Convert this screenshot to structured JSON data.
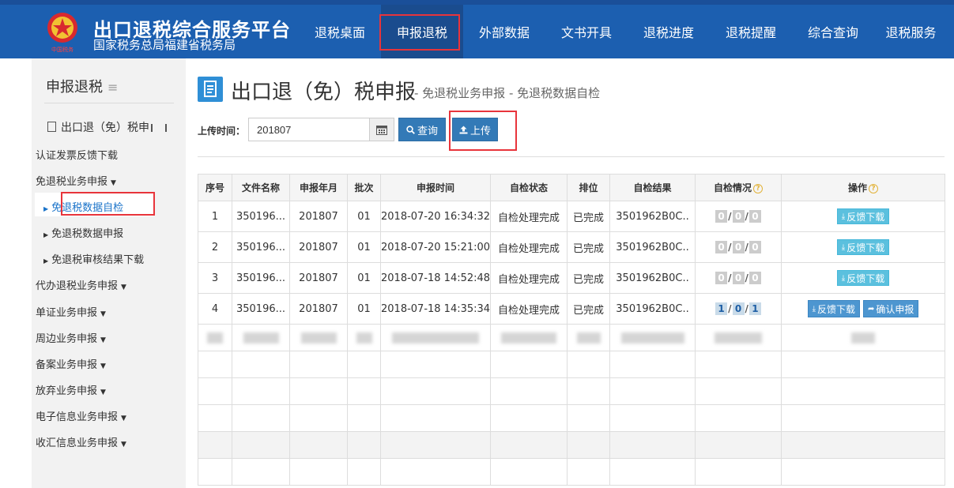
{
  "header": {
    "title": "出口退税综合服务平台",
    "subtitle": "国家税务总局福建省税务局",
    "logo_seal_text": "中国税务",
    "nav": [
      "退税桌面",
      "申报退税",
      "外部数据",
      "文书开具",
      "退税进度",
      "退税提醒",
      "综合查询",
      "退税服务"
    ],
    "active_nav": "申报退税"
  },
  "sidebar": {
    "title": "申报退税",
    "root": "出口退（免）税申",
    "items": [
      {
        "label": "认证发票反馈下载",
        "caret": false
      },
      {
        "label": "免退税业务申报",
        "caret": true
      }
    ],
    "sub_items": [
      "免退税数据自检",
      "免退税数据申报",
      "免退税审核结果下载"
    ],
    "active_sub": "免退税数据自检",
    "groups": [
      "代办退税业务申报",
      "单证业务申报",
      "周边业务申报",
      "备案业务申报",
      "放弃业务申报",
      "电子信息业务申报",
      "收汇信息业务申报"
    ]
  },
  "main": {
    "title": "出口退（免）税申报",
    "crumb": "- 免退税业务申报  - 免退税数据自检",
    "upload_time_label": "上传时间：",
    "upload_time_value": "201807",
    "query_label": "查询",
    "upload_label": "上传"
  },
  "table": {
    "headers": [
      "序号",
      "文件名称",
      "申报年月",
      "批次",
      "申报时间",
      "自检状态",
      "排位",
      "自检结果",
      "自检情况",
      "操作"
    ],
    "rows": [
      {
        "no": "1",
        "file": "350196...",
        "ym": "201807",
        "batch": "01",
        "time": "2018-07-20 16:34:32",
        "status": "自检处理完成",
        "rank": "已完成",
        "result": "3501962B0C..",
        "c": [
          "0",
          "0",
          "0"
        ],
        "active": false,
        "ops": [
          "反馈下载"
        ]
      },
      {
        "no": "2",
        "file": "350196...",
        "ym": "201807",
        "batch": "01",
        "time": "2018-07-20 15:21:00",
        "status": "自检处理完成",
        "rank": "已完成",
        "result": "3501962B0C..",
        "c": [
          "0",
          "0",
          "0"
        ],
        "active": false,
        "ops": [
          "反馈下载"
        ]
      },
      {
        "no": "3",
        "file": "350196...",
        "ym": "201807",
        "batch": "01",
        "time": "2018-07-18 14:52:48",
        "status": "自检处理完成",
        "rank": "已完成",
        "result": "3501962B0C..",
        "c": [
          "0",
          "0",
          "0"
        ],
        "active": false,
        "ops": [
          "反馈下载"
        ]
      },
      {
        "no": "4",
        "file": "350196...",
        "ym": "201807",
        "batch": "01",
        "time": "2018-07-18 14:35:34",
        "status": "自检处理完成",
        "rank": "已完成",
        "result": "3501962B0C..",
        "c": [
          "1",
          "0",
          "1"
        ],
        "active": true,
        "ops": [
          "反馈下载",
          "确认申报"
        ]
      }
    ],
    "empty_rows": 5
  },
  "colors": {
    "header_bg": "#1c5fb0",
    "highlight_red": "#e8343b",
    "primary_btn": "#337ab7",
    "info_btn": "#5bc0de"
  }
}
